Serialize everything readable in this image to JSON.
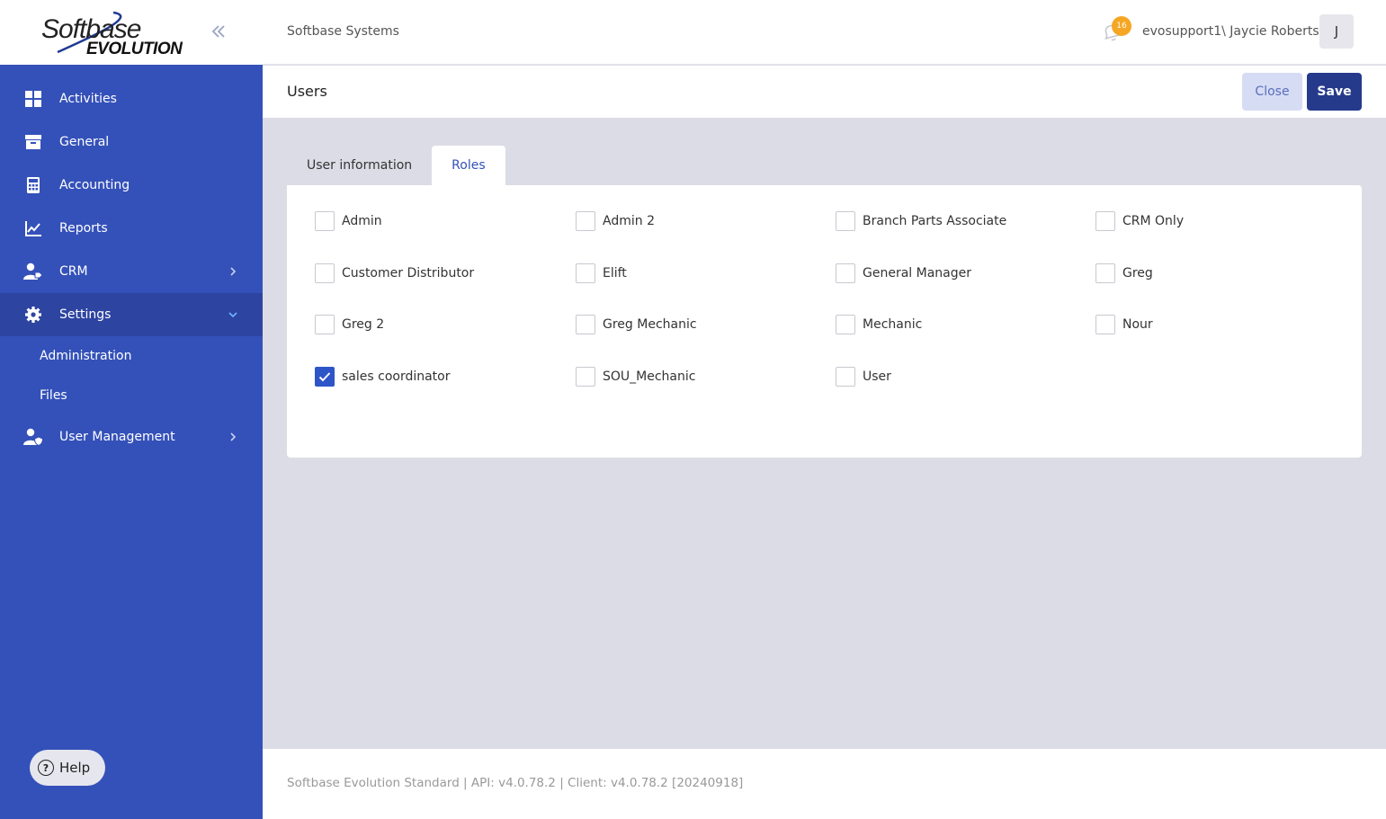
{
  "brand": {
    "logo_main": "Softbase",
    "logo_sub": "EVOLUTION"
  },
  "sidebar": {
    "items": [
      {
        "label": "Activities",
        "icon": "grid-icon"
      },
      {
        "label": "General",
        "icon": "archive-icon"
      },
      {
        "label": "Accounting",
        "icon": "calculator-icon"
      },
      {
        "label": "Reports",
        "icon": "chart-line-icon"
      },
      {
        "label": "CRM",
        "icon": "user-tag-icon",
        "chevron": "right"
      },
      {
        "label": "Settings",
        "icon": "gear-icon",
        "chevron": "down",
        "active": true
      }
    ],
    "sub_items": [
      {
        "label": "Administration"
      },
      {
        "label": "Files"
      }
    ],
    "user_management": {
      "label": "User Management",
      "icon": "user-shield-icon",
      "chevron": "right"
    },
    "help_label": "Help"
  },
  "header": {
    "company": "Softbase Systems",
    "notification_count": "16",
    "username": "evosupport1\\ Jaycie Roberts",
    "avatar_initial": "J"
  },
  "page": {
    "title": "Users",
    "close_label": "Close",
    "save_label": "Save"
  },
  "tabs": [
    {
      "label": "User information",
      "active": false
    },
    {
      "label": "Roles",
      "active": true
    }
  ],
  "roles": [
    {
      "label": "Admin",
      "checked": false
    },
    {
      "label": "Admin 2",
      "checked": false
    },
    {
      "label": "Branch Parts Associate",
      "checked": false
    },
    {
      "label": "CRM Only",
      "checked": false
    },
    {
      "label": "Customer Distributor",
      "checked": false
    },
    {
      "label": "Elift",
      "checked": false
    },
    {
      "label": "General Manager",
      "checked": false
    },
    {
      "label": "Greg",
      "checked": false
    },
    {
      "label": "Greg 2",
      "checked": false
    },
    {
      "label": "Greg Mechanic",
      "checked": false
    },
    {
      "label": "Mechanic",
      "checked": false
    },
    {
      "label": "Nour",
      "checked": false
    },
    {
      "label": "sales coordinator",
      "checked": true
    },
    {
      "label": "SOU_Mechanic",
      "checked": false
    },
    {
      "label": "User",
      "checked": false
    }
  ],
  "footer": {
    "text": "Softbase Evolution Standard | API: v4.0.78.2 | Client: v4.0.78.2 [20240918]"
  },
  "colors": {
    "sidebar": "#3451b9",
    "sidebar_active": "#2d44a0",
    "primary_button": "#263a8c",
    "secondary_button": "#d6dcf3",
    "badge": "#f5a623",
    "checkbox_checked": "#2d55c8"
  }
}
